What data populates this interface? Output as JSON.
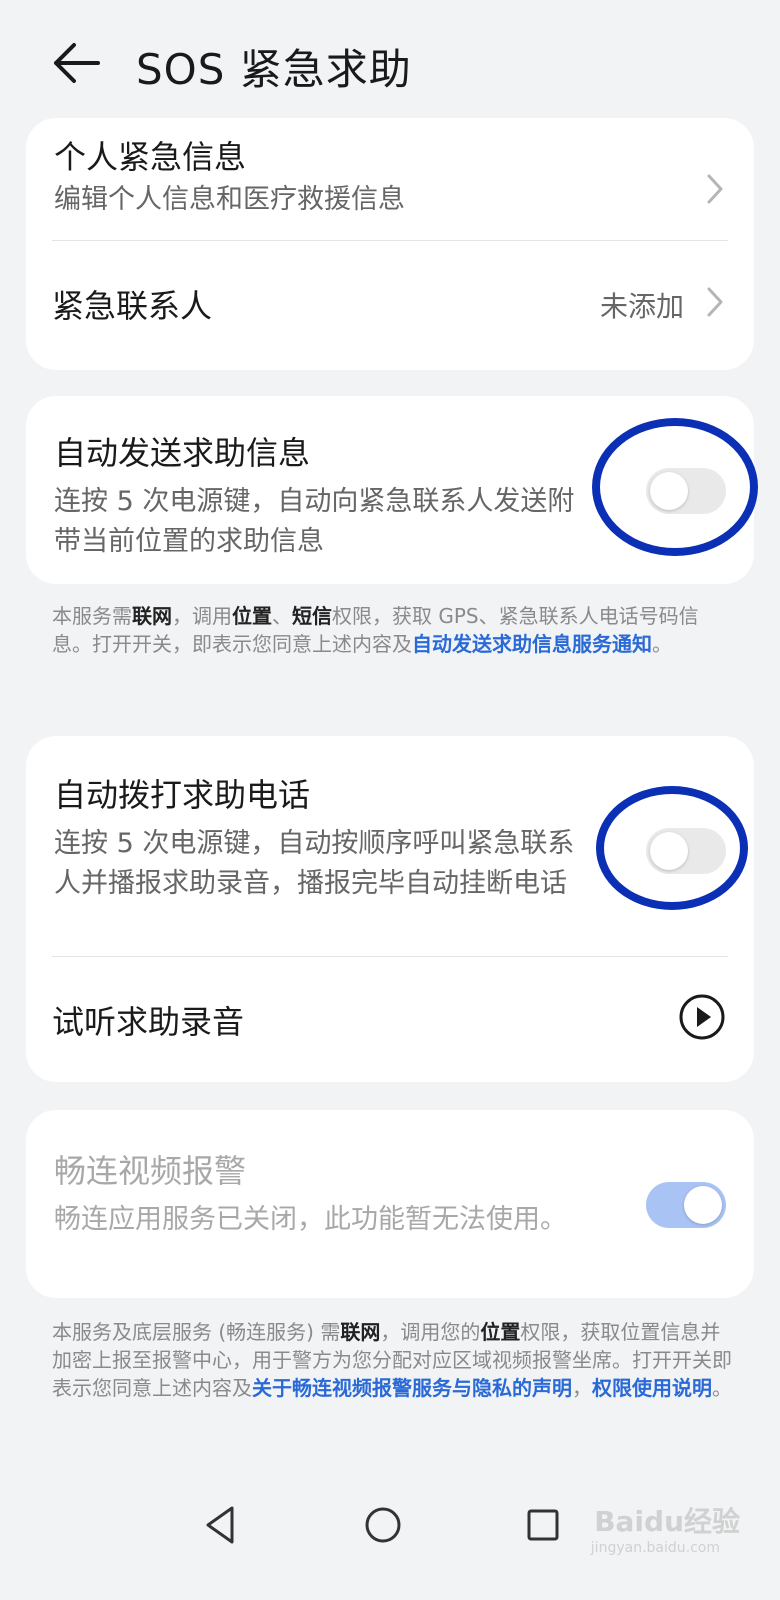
{
  "header": {
    "title": "SOS 紧急求助"
  },
  "personal_info": {
    "title": "个人紧急信息",
    "subtitle": "编辑个人信息和医疗救援信息"
  },
  "emergency_contact": {
    "title": "紧急联系人",
    "value": "未添加"
  },
  "auto_sms": {
    "title": "自动发送求助信息",
    "subtitle": "连按 5 次电源键，自动向紧急联系人发送附带当前位置的求助信息",
    "enabled": false
  },
  "note1": {
    "p1": "本服务需",
    "b1": "联网",
    "p2": "，调用",
    "b2": "位置",
    "p3": "、",
    "b3": "短信",
    "p4": "权限，获取 GPS、紧急联系人电话号码信息。打开开关，即表示您同意上述内容及",
    "link": "自动发送求助信息服务通知",
    "p5": "。"
  },
  "auto_call": {
    "title": "自动拨打求助电话",
    "subtitle": "连按 5 次电源键，自动按顺序呼叫紧急联系人并播报求助录音，播报完毕自动挂断电话",
    "enabled": false
  },
  "listen_recording": {
    "title": "试听求助录音"
  },
  "video_alarm": {
    "title": "畅连视频报警",
    "subtitle": "畅连应用服务已关闭，此功能暂无法使用。",
    "enabled": true
  },
  "note2": {
    "p1": "本服务及底层服务 (畅连服务) 需",
    "b1": "联网",
    "p2": "，调用您的",
    "b2": "位置",
    "p3": "权限，获取位置信息并加密上报至报警中心，用于警方为您分配对应区域视频报警坐席。打开开关即表示您同意上述内容及",
    "link1": "关于畅连视频报警服务与隐私的声明",
    "p4": "，",
    "link2": "权限使用说明",
    "p5": "。"
  },
  "watermark": {
    "brand": "Baidu经验",
    "sub": "jingyan.baidu.com"
  },
  "colors": {
    "accent": "#2a6ad6",
    "annotation": "#0b2fb5",
    "toggle_on": "#a9c3f5"
  }
}
